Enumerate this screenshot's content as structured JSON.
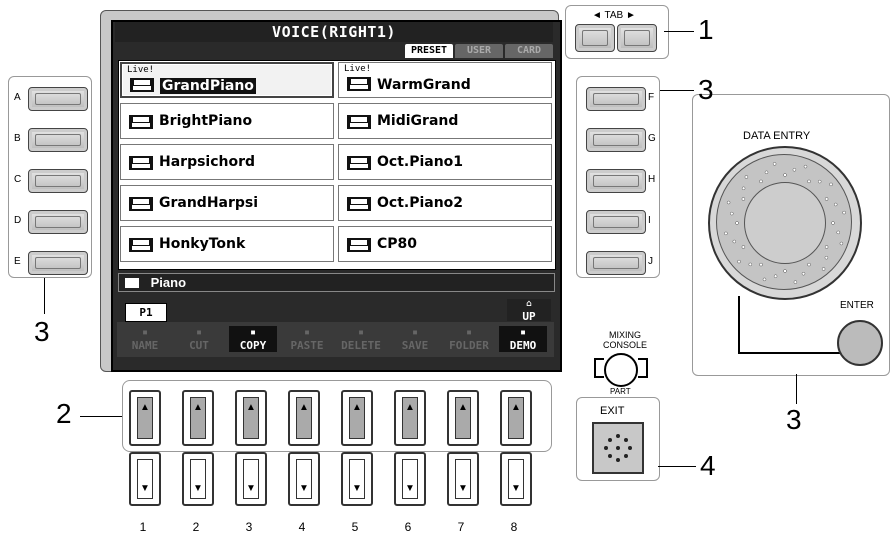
{
  "screen": {
    "title": "VOICE(RIGHT1)",
    "tabs": [
      "PRESET",
      "USER",
      "CARD"
    ],
    "active_tab": "PRESET",
    "voices": [
      {
        "name": "GrandPiano",
        "live": "Live!",
        "selected": true,
        "icon": "grand-piano-icon"
      },
      {
        "name": "WarmGrand",
        "live": "Live!",
        "selected": false,
        "icon": "grand-piano-icon"
      },
      {
        "name": "BrightPiano",
        "live": "",
        "selected": false,
        "icon": "piano-icon"
      },
      {
        "name": "MidiGrand",
        "live": "",
        "selected": false,
        "icon": "grand-piano-icon"
      },
      {
        "name": "Harpsichord",
        "live": "",
        "selected": false,
        "icon": "harpsichord-icon"
      },
      {
        "name": "Oct.Piano1",
        "live": "",
        "selected": false,
        "icon": "upright-piano-icon"
      },
      {
        "name": "GrandHarpsi",
        "live": "",
        "selected": false,
        "icon": "harpsichord-icon"
      },
      {
        "name": "Oct.Piano2",
        "live": "",
        "selected": false,
        "icon": "upright-piano-icon"
      },
      {
        "name": "HonkyTonk",
        "live": "",
        "selected": false,
        "icon": "upright-piano-icon"
      },
      {
        "name": "CP80",
        "live": "",
        "selected": false,
        "icon": "piano-icon"
      }
    ],
    "folder": "Piano",
    "page": "P1",
    "up_label": "UP",
    "functions": [
      {
        "label": "NAME",
        "active": false
      },
      {
        "label": "CUT",
        "active": false
      },
      {
        "label": "COPY",
        "active": true
      },
      {
        "label": "PASTE",
        "active": false
      },
      {
        "label": "DELETE",
        "active": false
      },
      {
        "label": "SAVE",
        "active": false
      },
      {
        "label": "FOLDER",
        "active": false
      },
      {
        "label": "DEMO",
        "active": true
      }
    ]
  },
  "panel": {
    "left_buttons": [
      "A",
      "B",
      "C",
      "D",
      "E"
    ],
    "right_buttons": [
      "F",
      "G",
      "H",
      "I",
      "J"
    ],
    "tab_label": "TAB",
    "data_entry_label": "DATA ENTRY",
    "enter_label": "ENTER",
    "mixing_console_label": "MIXING CONSOLE",
    "part_label": "PART",
    "exit_label": "EXIT",
    "slider_numbers": [
      "1",
      "2",
      "3",
      "4",
      "5",
      "6",
      "7",
      "8"
    ]
  },
  "callouts": {
    "tab": "1",
    "sliders": "2",
    "left_buttons": "3",
    "right_buttons": "3",
    "data_entry": "3",
    "exit": "4"
  }
}
